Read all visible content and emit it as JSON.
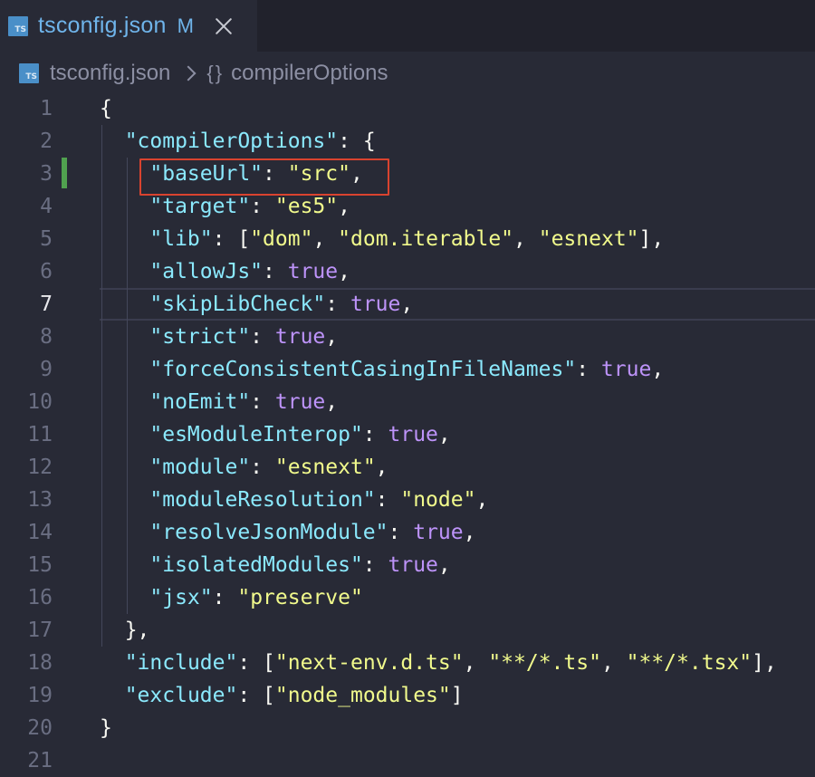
{
  "tab": {
    "file_name": "tsconfig.json",
    "status": "M",
    "icon": "ts-file-icon",
    "icon_text": "TS"
  },
  "breadcrumb": {
    "file": "tsconfig.json",
    "object_icon": "{}",
    "object": "compilerOptions"
  },
  "editor": {
    "current_line": 7,
    "modified_line": 3,
    "lines": [
      {
        "n": "1",
        "text": "{"
      },
      {
        "n": "2",
        "text": "  \"compilerOptions\": {"
      },
      {
        "n": "3",
        "text": "    \"baseUrl\": \"src\","
      },
      {
        "n": "4",
        "text": "    \"target\": \"es5\","
      },
      {
        "n": "5",
        "text": "    \"lib\": [\"dom\", \"dom.iterable\", \"esnext\"],"
      },
      {
        "n": "6",
        "text": "    \"allowJs\": true,"
      },
      {
        "n": "7",
        "text": "    \"skipLibCheck\": true,"
      },
      {
        "n": "8",
        "text": "    \"strict\": true,"
      },
      {
        "n": "9",
        "text": "    \"forceConsistentCasingInFileNames\": true,"
      },
      {
        "n": "10",
        "text": "    \"noEmit\": true,"
      },
      {
        "n": "11",
        "text": "    \"esModuleInterop\": true,"
      },
      {
        "n": "12",
        "text": "    \"module\": \"esnext\","
      },
      {
        "n": "13",
        "text": "    \"moduleResolution\": \"node\","
      },
      {
        "n": "14",
        "text": "    \"resolveJsonModule\": true,"
      },
      {
        "n": "15",
        "text": "    \"isolatedModules\": true,"
      },
      {
        "n": "16",
        "text": "    \"jsx\": \"preserve\""
      },
      {
        "n": "17",
        "text": "  },"
      },
      {
        "n": "18",
        "text": "  \"include\": [\"next-env.d.ts\", \"**/*.ts\", \"**/*.tsx\"],"
      },
      {
        "n": "19",
        "text": "  \"exclude\": [\"node_modules\"]"
      },
      {
        "n": "20",
        "text": "}"
      },
      {
        "n": "21",
        "text": ""
      }
    ]
  },
  "colors": {
    "background": "#282a36",
    "key": "#8be9fd",
    "string": "#f1fa8c",
    "boolean": "#bd93f9",
    "highlight_box": "#d9432f",
    "modified_gutter": "#50a14f"
  }
}
